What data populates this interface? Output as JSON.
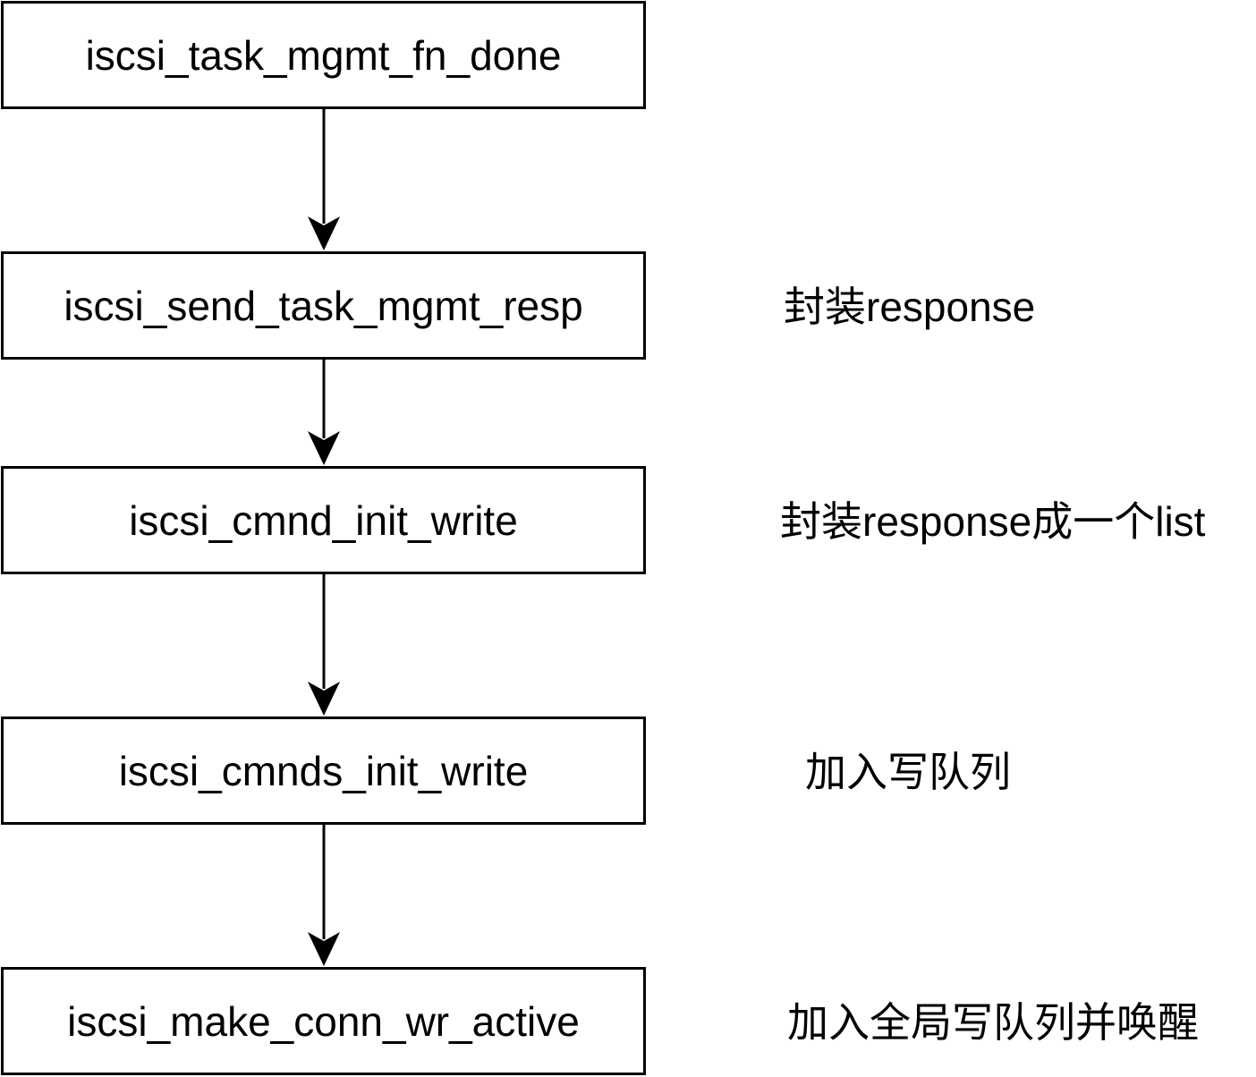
{
  "nodes": [
    {
      "label": "iscsi_task_mgmt_fn_done"
    },
    {
      "label": "iscsi_send_task_mgmt_resp"
    },
    {
      "label": "iscsi_cmnd_init_write"
    },
    {
      "label": "iscsi_cmnds_init_write"
    },
    {
      "label": "iscsi_make_conn_wr_active"
    }
  ],
  "annotations": [
    {
      "text": "封装response"
    },
    {
      "text": "封装response成一个list"
    },
    {
      "text": "加入写队列"
    },
    {
      "text": "加入全局写队列并唤醒"
    }
  ],
  "edges": [
    {
      "from": 0,
      "to": 1
    },
    {
      "from": 1,
      "to": 2
    },
    {
      "from": 2,
      "to": 3
    },
    {
      "from": 3,
      "to": 4
    }
  ],
  "colors": {
    "stroke": "#000000",
    "fill": "#ffffff",
    "text": "#000000"
  }
}
